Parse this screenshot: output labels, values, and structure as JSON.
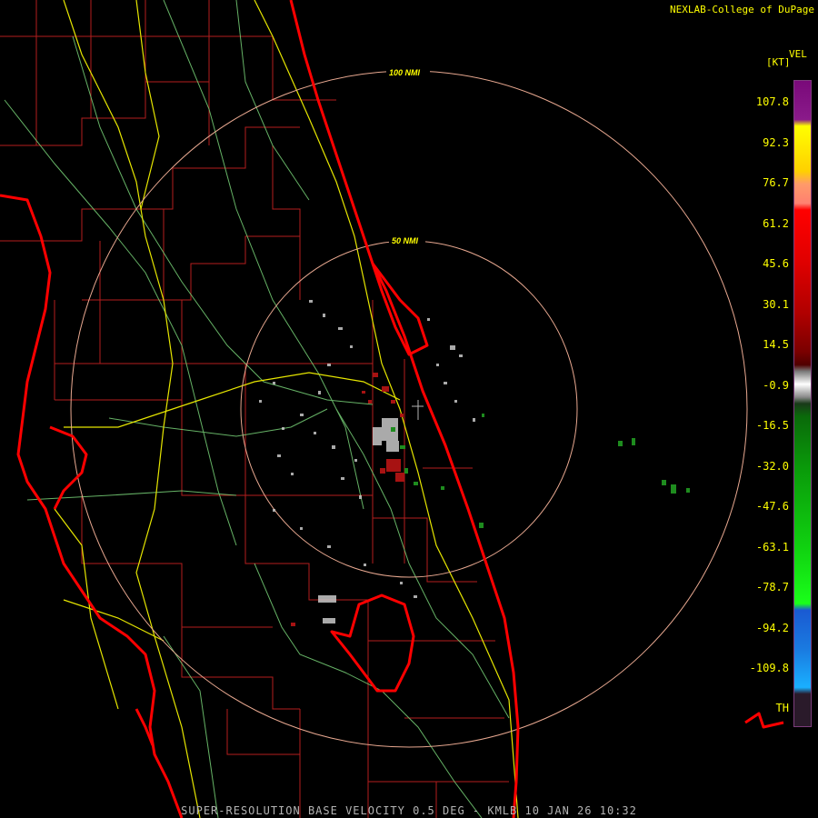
{
  "header": {
    "credit": "NEXLAB-College of DuPage"
  },
  "legend": {
    "product": "VEL",
    "unit": "[KT]",
    "ticks": [
      "107.8",
      "92.3",
      "76.7",
      "61.2",
      "45.6",
      "30.1",
      "14.5",
      "-0.9",
      "-16.5",
      "-32.0",
      "-47.6",
      "-63.1",
      "-78.7",
      "-94.2",
      "-109.8"
    ],
    "bottom_label": "TH"
  },
  "rings": {
    "inner_label": "50 NMI",
    "outer_label": "100 NMI"
  },
  "footer": {
    "caption": "SUPER-RESOLUTION BASE VELOCITY 0.5 DEG - KMLB 10 JAN 26 10:32"
  },
  "colors": {
    "county": "#b41e1e",
    "coast": "#ff0000",
    "highway_major": "#e6e600",
    "highway_minor": "#78d278",
    "ring": "#e8a890"
  }
}
